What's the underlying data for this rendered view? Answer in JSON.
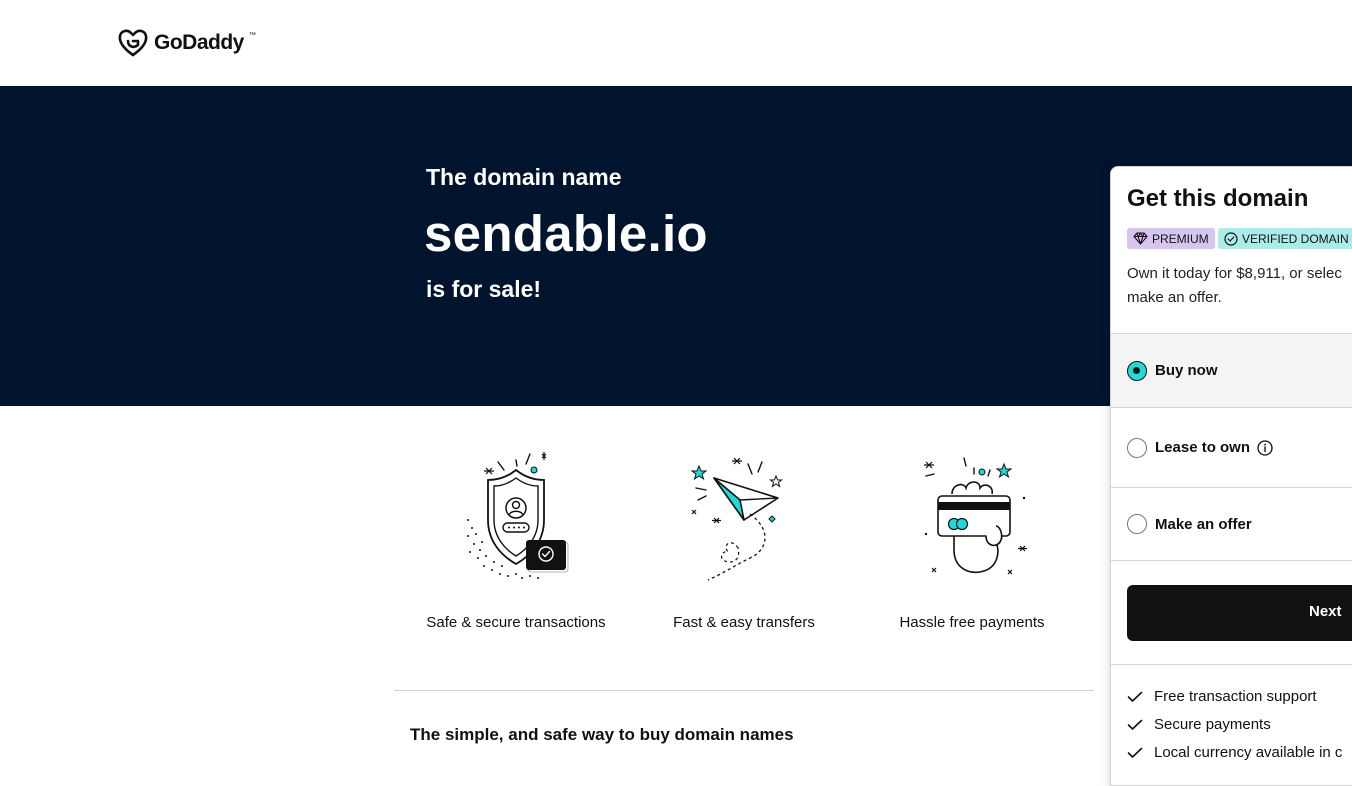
{
  "header": {
    "logo_text": "GoDaddy",
    "logo_mark": "™"
  },
  "hero": {
    "pre_text": "The domain name",
    "domain": "sendable.io",
    "post_text": "is for sale!"
  },
  "features": [
    {
      "label": "Safe & secure transactions",
      "icon": "shield-check-icon"
    },
    {
      "label": "Fast & easy transfers",
      "icon": "paper-plane-icon"
    },
    {
      "label": "Hassle free payments",
      "icon": "card-payment-icon"
    }
  ],
  "section": {
    "title": "The simple, and safe way to buy domain names"
  },
  "panel": {
    "title": "Get this domain",
    "badges": {
      "premium": "PREMIUM",
      "verified": "VERIFIED DOMAIN"
    },
    "description_line1": "Own it today for $8,911, or selec",
    "description_line2": "make an offer.",
    "options": [
      {
        "label": "Buy now",
        "selected": true
      },
      {
        "label": "Lease to own",
        "selected": false
      },
      {
        "label": "Make an offer",
        "selected": false
      }
    ],
    "next_label": "Next",
    "benefits": [
      "Free transaction support",
      "Secure payments",
      "Local currency available in c"
    ]
  },
  "colors": {
    "hero_bg": "#00142e",
    "accent_teal": "#1bdbdb",
    "premium_badge": "#d8c5ef",
    "verified_badge": "#a9ece8",
    "button_bg": "#111111"
  }
}
